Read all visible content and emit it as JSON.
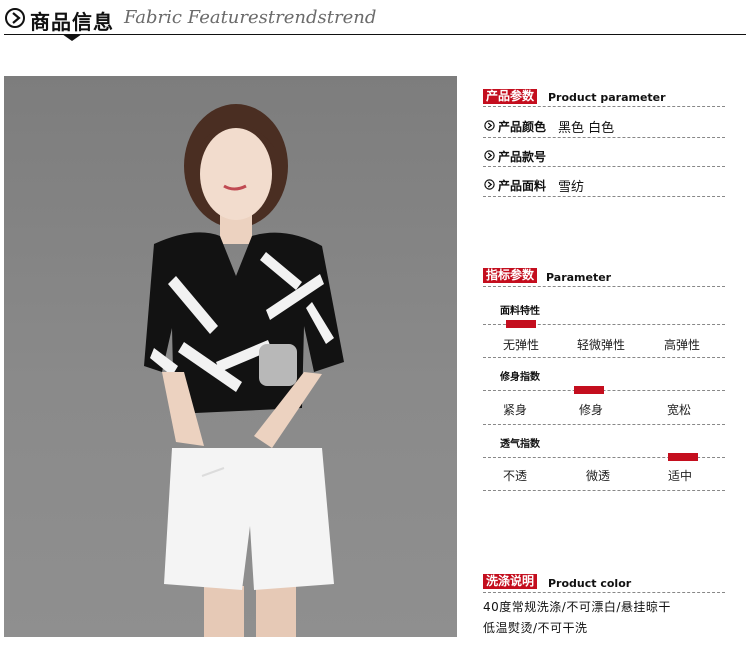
{
  "header": {
    "title": "商品信息",
    "subtitle": "Fabric Featurestrendstrend",
    "icon": "circle-arrow-icon"
  },
  "photo": {
    "subject": "model-photo",
    "color_accent": "#c40e1e"
  },
  "product_parameter": {
    "tag": "产品参数",
    "title_en": "Product parameter",
    "rows": [
      {
        "label": "产品颜色",
        "value": "黑色 白色"
      },
      {
        "label": "产品款号",
        "value": ""
      },
      {
        "label": "产品面料",
        "value": "雪纺"
      }
    ]
  },
  "parameter": {
    "tag": "指标参数",
    "title_en": "Parameter",
    "groups": [
      {
        "title": "面料特性",
        "options": [
          "无弹性",
          "轻微弹性",
          "高弹性"
        ],
        "selected_index": 0
      },
      {
        "title": "修身指数",
        "options": [
          "紧身",
          "修身",
          "宽松"
        ],
        "selected_index": 1
      },
      {
        "title": "透气指数",
        "options": [
          "不透",
          "微透",
          "适中"
        ],
        "selected_index": 2
      }
    ]
  },
  "care": {
    "tag": "洗涤说明",
    "title_en": "Product color",
    "lines": [
      "40度常规洗涤/不可漂白/悬挂晾干",
      "低温熨烫/不可干洗"
    ]
  },
  "colors": {
    "accent": "#c40e1e",
    "text": "#111111",
    "divider": "#888888"
  }
}
